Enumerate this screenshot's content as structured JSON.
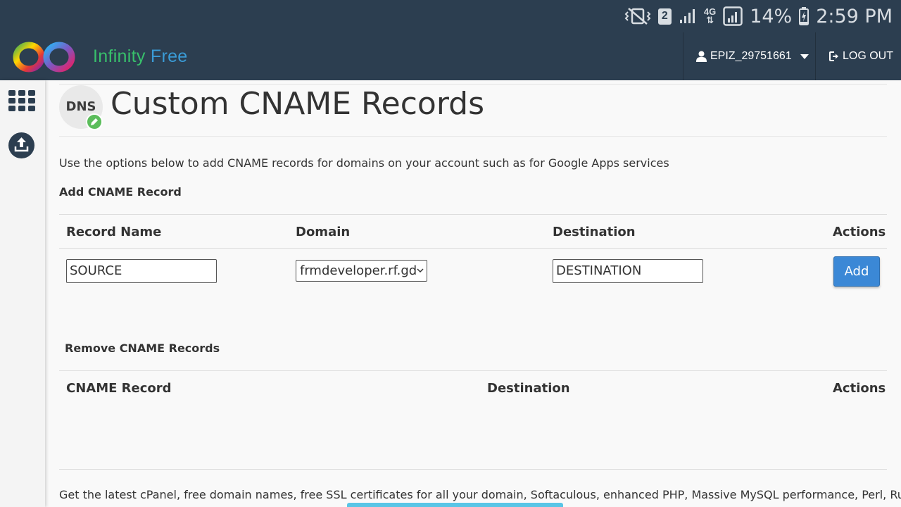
{
  "status_bar": {
    "sim_label": "2",
    "network_label": "4G",
    "battery_percent": "14%",
    "time": "2:59 PM"
  },
  "header": {
    "brand_word1": "Infinity",
    "brand_word2": "Free",
    "username": "EPIZ_29751661",
    "logout_label": "LOG OUT"
  },
  "sidebar": {
    "items": [
      {
        "icon": "grid-icon"
      },
      {
        "icon": "upload-icon"
      }
    ]
  },
  "page": {
    "badge_text": "DNS",
    "title": "Custom CNAME Records",
    "description": "Use the options below to add CNAME records for domains on your account such as for Google Apps services"
  },
  "add_section": {
    "heading": "Add CNAME Record",
    "columns": [
      "Record Name",
      "Domain",
      "Destination",
      "Actions"
    ],
    "record_name_value": "SOURCE",
    "domain_selected": "frmdeveloper.rf.gd",
    "destination_value": "DESTINATION",
    "add_label": "Add"
  },
  "remove_section": {
    "heading": "Remove CNAME Records",
    "columns": [
      "CNAME Record",
      "Destination",
      "Actions"
    ],
    "rows": []
  },
  "footer": {
    "text": "Get the latest cPanel, free domain names, free SSL certificates for all your domain, Softaculous, enhanced PHP, Massive MySQL performance, Perl, Ruby on"
  },
  "colors": {
    "header_bg": "#2c3e50",
    "brand_green": "#38c06b",
    "brand_blue": "#3a9bd6",
    "button_blue": "#3b88d6"
  }
}
